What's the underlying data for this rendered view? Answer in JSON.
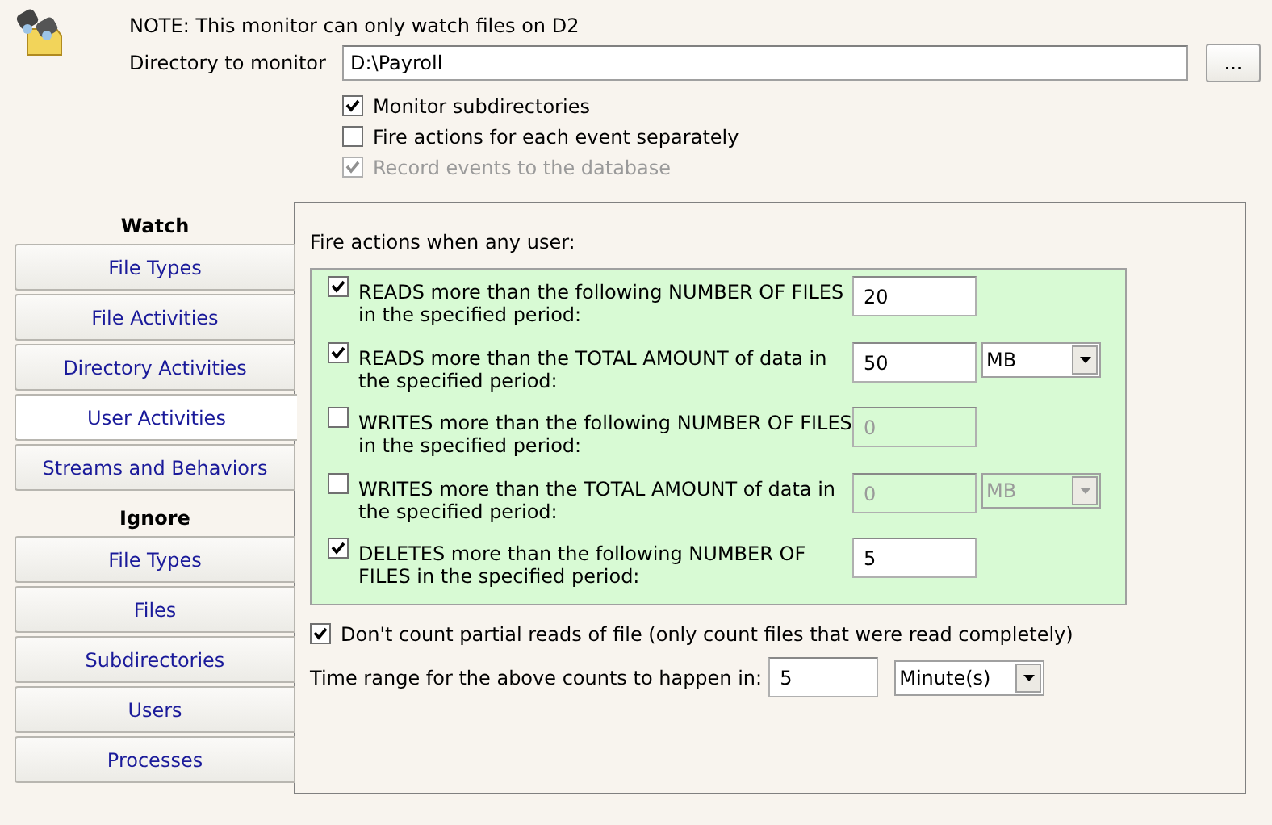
{
  "note": "NOTE: This monitor can only watch files on D2",
  "directory": {
    "label": "Directory to monitor",
    "value": "D:\\Payroll",
    "browse": "..."
  },
  "options": [
    {
      "label": "Monitor subdirectories",
      "checked": true,
      "disabled": false
    },
    {
      "label": "Fire actions for each event separately",
      "checked": false,
      "disabled": false
    },
    {
      "label": "Record events to the database",
      "checked": true,
      "disabled": true
    }
  ],
  "sidebar": [
    {
      "heading": "Watch",
      "items": [
        {
          "label": "File Types",
          "selected": false
        },
        {
          "label": "File Activities",
          "selected": false
        },
        {
          "label": "Directory Activities",
          "selected": false
        },
        {
          "label": "User Activities",
          "selected": true
        },
        {
          "label": "Streams and Behaviors",
          "selected": false
        }
      ]
    },
    {
      "heading": "Ignore",
      "items": [
        {
          "label": "File Types",
          "selected": false
        },
        {
          "label": "Files",
          "selected": false
        },
        {
          "label": "Subdirectories",
          "selected": false
        },
        {
          "label": "Users",
          "selected": false
        },
        {
          "label": "Processes",
          "selected": false
        }
      ]
    }
  ],
  "panel": {
    "intro": "Fire actions when any user:",
    "rules": [
      {
        "label": "READS more than the following NUMBER OF FILES in the specified period:",
        "checked": true,
        "value": "20"
      },
      {
        "label": "READS more than the TOTAL AMOUNT of data in the specified period:",
        "checked": true,
        "value": "50",
        "unit": "MB"
      },
      {
        "label": "WRITES more than the following NUMBER OF FILES in the specified period:",
        "checked": false,
        "value": "0"
      },
      {
        "label": "WRITES more than the TOTAL AMOUNT of data in the specified period:",
        "checked": false,
        "value": "0",
        "unit": "MB"
      },
      {
        "label": "DELETES more than the following NUMBER OF FILES in the specified period:",
        "checked": true,
        "value": "5"
      }
    ],
    "partial": {
      "label": "Don't count partial reads of file (only count files that were read completely)",
      "checked": true
    },
    "time_range": {
      "label": "Time range for the above counts to happen in:",
      "value": "5",
      "unit": "Minute(s)"
    }
  }
}
